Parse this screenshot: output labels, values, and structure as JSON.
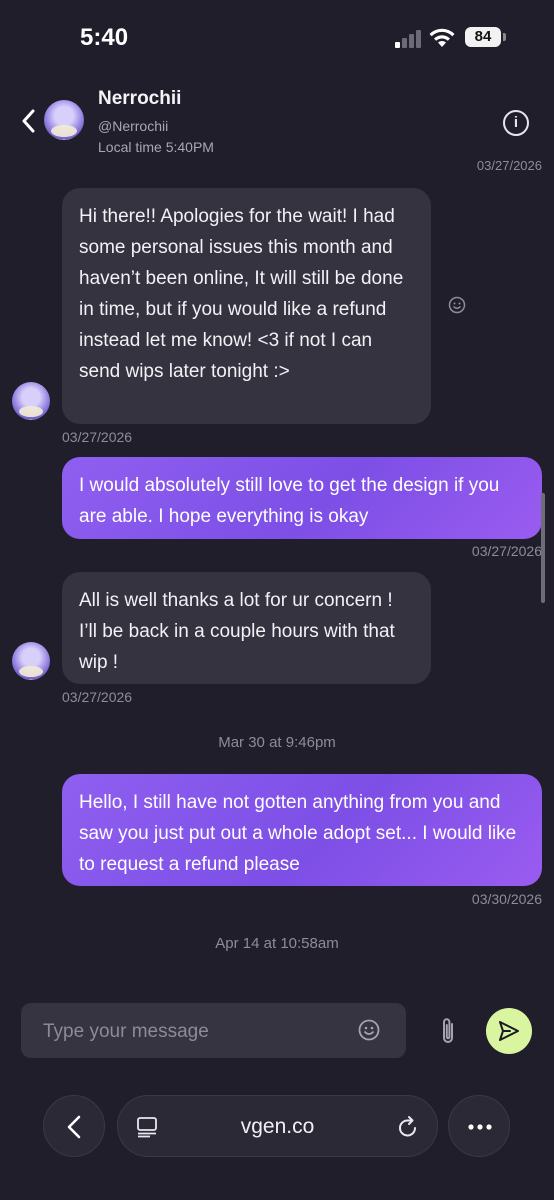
{
  "status": {
    "time": "5:40",
    "battery": "84"
  },
  "header": {
    "name": "Nerrochii",
    "handle": "@Nerrochii",
    "local_time": "Local time 5:40PM"
  },
  "messages": {
    "cut_date": "03/27/2026",
    "m1": {
      "text": "Hi there!! Apologies for the wait! I had some personal issues this month and haven’t been online, It will still be done in time, but if you would like a refund instead let me know! <3 if not I can send wips later tonight :>",
      "date": "03/27/2026"
    },
    "m2": {
      "text": "I would absolutely still love to get the design if you are able. I hope everything is okay",
      "date": "03/27/2026"
    },
    "m3": {
      "text": "All is well thanks a lot for ur concern ! I’ll be back in a couple hours with that wip !",
      "date": "03/27/2026"
    },
    "divider1": "Mar 30 at 9:46pm",
    "m4": {
      "text": "Hello, I still have not gotten anything from you and saw you just put out a whole adopt set... I would like to request a refund please",
      "date": "03/30/2026"
    },
    "divider2": "Apr 14 at 10:58am"
  },
  "composer": {
    "placeholder": "Type your message"
  },
  "browser": {
    "url": "vgen.co"
  },
  "colors": {
    "background": "#1f1e2a",
    "incoming": "#34333f",
    "outgoing": "#8f5ff0",
    "send": "#d9f5a0"
  }
}
